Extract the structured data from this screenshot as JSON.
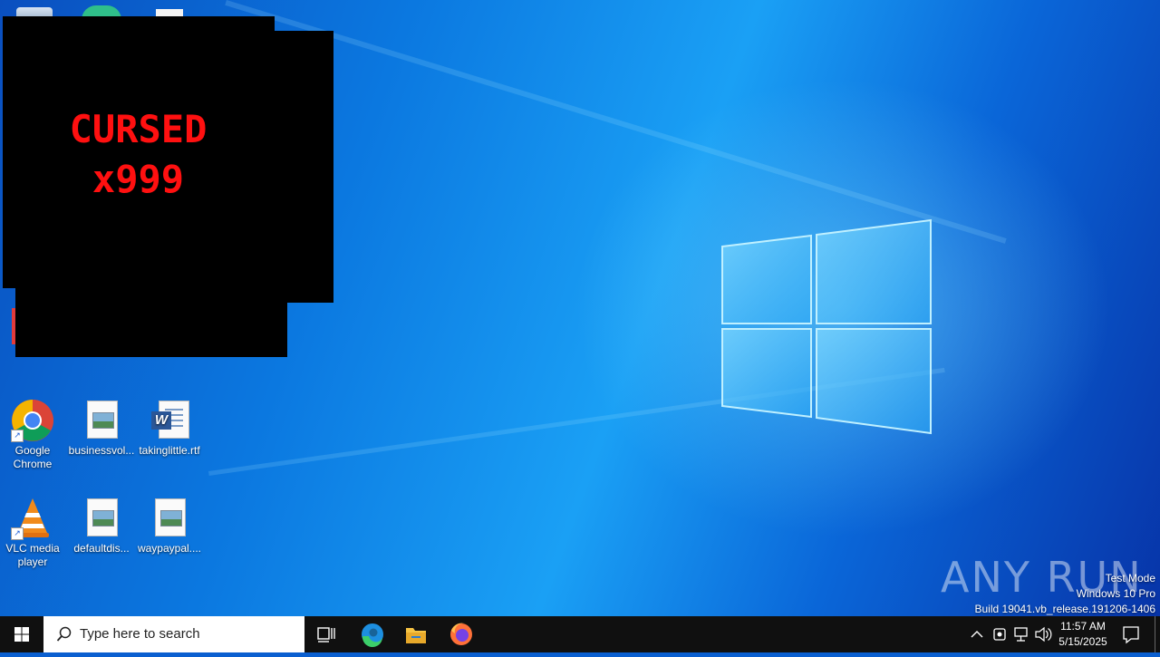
{
  "popup": {
    "line1": "CURSED",
    "line2": "x999",
    "text_color": "#ff1010"
  },
  "desktop_icons": [
    {
      "label": "Google\nChrome",
      "icon": "chrome-icon"
    },
    {
      "label": "businessvol...",
      "icon": "image-file-icon"
    },
    {
      "label": "takinglittle.rtf",
      "icon": "word-document-icon"
    },
    {
      "label": "VLC media\nplayer",
      "icon": "vlc-icon"
    },
    {
      "label": "defaultdis...",
      "icon": "image-file-icon"
    },
    {
      "label": "waypaypal....",
      "icon": "image-file-icon"
    }
  ],
  "watermark": {
    "logo": "ANY RUN",
    "mode": "Test Mode",
    "edition": "Windows 10 Pro",
    "build": "Build 19041.vb_release.191206-1406"
  },
  "taskbar": {
    "search_placeholder": "Type here to search",
    "time": "11:57 AM",
    "date": "5/15/2025",
    "pinned": [
      "task-view",
      "edge",
      "file-explorer",
      "firefox"
    ]
  }
}
